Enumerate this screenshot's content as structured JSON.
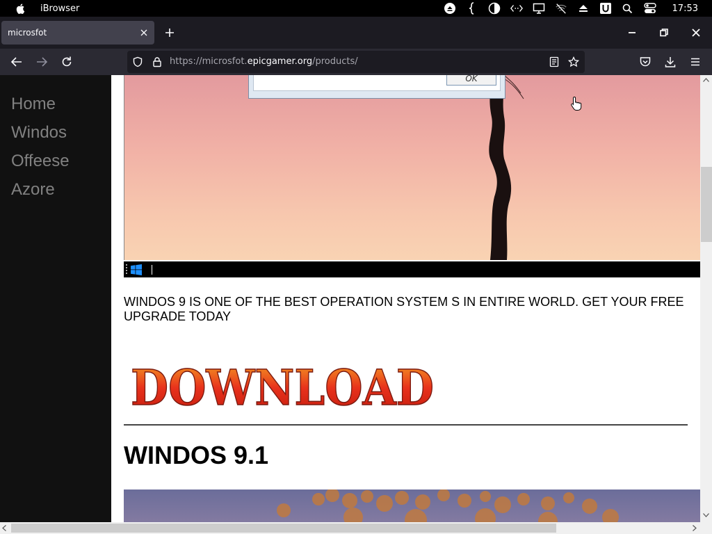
{
  "os": {
    "app_name": "iBrowser",
    "clock": "17:53"
  },
  "tab": {
    "title": "microsfot"
  },
  "nav": {
    "url_prefix": "https://microsfot.",
    "url_domain": "epicgamer.org",
    "url_path": "/products/"
  },
  "sidebar": {
    "items": [
      {
        "label": "Home"
      },
      {
        "label": "Windos"
      },
      {
        "label": "Offeese"
      },
      {
        "label": "Azore"
      }
    ]
  },
  "main": {
    "dialog_ok_label": "OK",
    "promo_text": "WINDOS 9 IS ONE OF THE BEST OPERATION SYSTEM S IN ENTIRE WORLD. GET YOUR FREE UPGRADE TODAY",
    "download_label": "DOWNLOAD",
    "heading": "WINDOS 9.1"
  },
  "colors": {
    "sidebar_bg": "#111111",
    "sidebar_text": "#818181",
    "download_fill": "#e8321c"
  }
}
